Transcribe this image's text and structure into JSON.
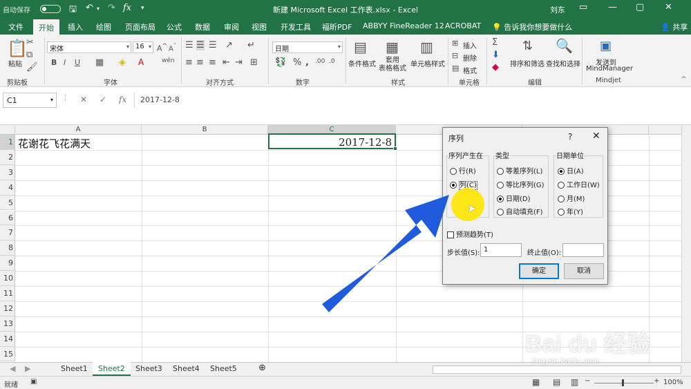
{
  "titlebar": {
    "autosave": "自动保存",
    "title": "新建 Microsoft Excel 工作表.xlsx - Excel",
    "user": "刘东"
  },
  "tabs": [
    "文件",
    "开始",
    "插入",
    "绘图",
    "页面布局",
    "公式",
    "数据",
    "审阅",
    "视图",
    "开发工具",
    "福昕PDF",
    "ABBYY FineReader 12",
    "ACROBAT"
  ],
  "tellme": "告诉我你想要做什么",
  "share": "共享",
  "ribbon": {
    "paste": "粘贴",
    "clipboard": "剪贴板",
    "font_name": "宋体",
    "font_size": "16",
    "font_group": "字体",
    "align_group": "对齐方式",
    "number_format": "日期",
    "number_group": "数字",
    "cond_format": "条件格式",
    "table_format": "套用\n表格格式",
    "cell_style": "单元格样式",
    "style_group": "样式",
    "insert": "插入",
    "delete": "删除",
    "format": "格式",
    "cells_group": "单元格",
    "sort_filter": "排序和筛选",
    "find_select": "查找和选择",
    "edit_group": "编辑",
    "send_to": "发送到",
    "mindmanager": "MindManager",
    "mindjet": "Mindjet"
  },
  "formula_bar": {
    "name_box": "C1",
    "formula": "2017-12-8"
  },
  "grid": {
    "columns": [
      "A",
      "B",
      "C"
    ],
    "rows": [
      "1",
      "2",
      "3",
      "4",
      "5",
      "6",
      "7",
      "8",
      "9",
      "10",
      "11",
      "12",
      "13",
      "14",
      "15"
    ],
    "a1": "花谢花飞花满天",
    "c1": "2017-12-8"
  },
  "sheets": [
    "Sheet1",
    "Sheet2",
    "Sheet3",
    "Sheet4",
    "Sheet5"
  ],
  "active_sheet": "Sheet2",
  "status": {
    "ready": "就绪",
    "zoom": "100%"
  },
  "dialog": {
    "title": "序列",
    "help": "?",
    "series_in_label": "序列产生在",
    "series_in": [
      {
        "label": "行(R)",
        "checked": false
      },
      {
        "label": "列(C)",
        "checked": true
      }
    ],
    "type_label": "类型",
    "types": [
      {
        "label": "等差序列(L)",
        "checked": false
      },
      {
        "label": "等比序列(G)",
        "checked": false
      },
      {
        "label": "日期(D)",
        "checked": true
      },
      {
        "label": "自动填充(F)",
        "checked": false
      }
    ],
    "date_unit_label": "日期单位",
    "date_units": [
      {
        "label": "日(A)",
        "checked": true
      },
      {
        "label": "工作日(W)",
        "checked": false
      },
      {
        "label": "月(M)",
        "checked": false
      },
      {
        "label": "年(Y)",
        "checked": false
      }
    ],
    "trend": "预测趋势(T)",
    "step_label": "步长值(S):",
    "step_value": "1",
    "stop_label": "终止值(O):",
    "stop_value": "",
    "ok": "确定",
    "cancel": "取消"
  },
  "watermark": {
    "main": "Bai du 经验",
    "sub": "jingyan.baidu.com"
  },
  "colors": {
    "excel_green": "#217346",
    "arrow_blue": "#1f5bdc",
    "highlight_yellow": "#ffe600"
  }
}
